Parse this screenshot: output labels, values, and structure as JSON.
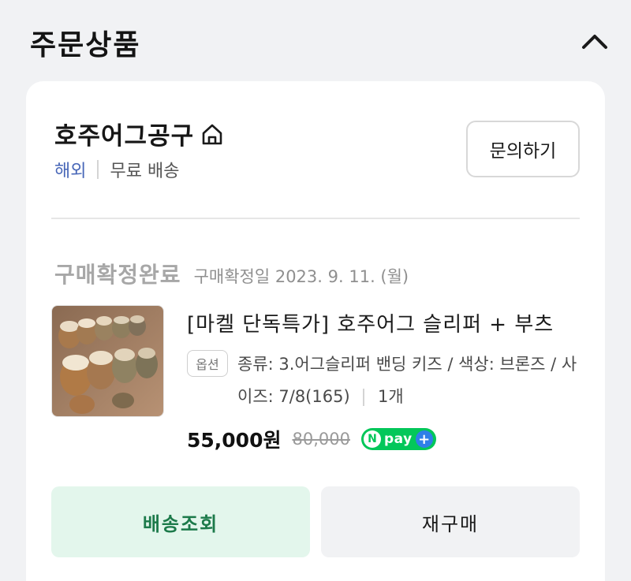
{
  "header": {
    "title": "주문상품",
    "collapse_icon": "chevron-up-icon"
  },
  "store": {
    "name": "호주어그공구",
    "store_icon": "home-icon",
    "origin": "해외",
    "shipping": "무료 배송",
    "inquiry_label": "문의하기"
  },
  "order": {
    "status": "구매확정완료",
    "confirm_date": "구매확정일 2023. 9. 11. (월)"
  },
  "product": {
    "image_icon": "product-photo-ugg-slippers",
    "name": "[마켈 단독특가] 호주어그 슬리퍼 + 부츠",
    "option_badge": "옵션",
    "option_text": "종류: 3.어그슬리퍼 밴딩 키즈 / 색상: 브론즈 / 사이즈: 7/8(165)",
    "quantity": "1개",
    "price": "55,000원",
    "original_price": "80,000",
    "npay_n": "N",
    "npay_word": "pay",
    "npay_plus": "+"
  },
  "actions": {
    "track_label": "배송조회",
    "reorder_label": "재구매"
  },
  "colors": {
    "overseas_text": "#4867b8",
    "track_button_bg": "#e3f6ec",
    "track_button_text": "#1c7a4a",
    "npay_green": "#03c75a",
    "npay_plus_blue": "#2f7fe8"
  }
}
